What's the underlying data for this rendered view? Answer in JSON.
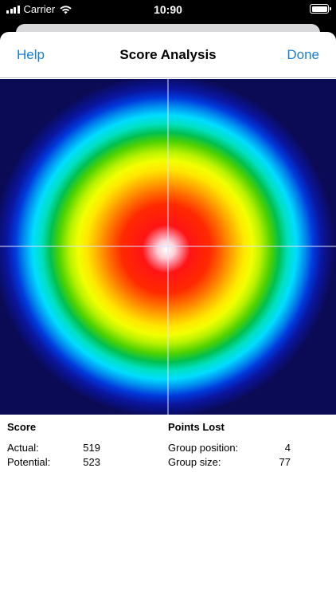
{
  "status_bar": {
    "carrier": "Carrier",
    "time": "10:90"
  },
  "navbar": {
    "help_label": "Help",
    "title": "Score Analysis",
    "done_label": "Done"
  },
  "heatmap": {
    "background_color": "#0b0a55",
    "crosshair_color": "#dde3ff",
    "ring_colors": [
      "#ffffff",
      "#ffd0d8",
      "#ff7a88",
      "#ff1414",
      "#ff2a00",
      "#ff6a00",
      "#ffb000",
      "#ffe800",
      "#f2ff00",
      "#b8f200",
      "#4fd200",
      "#00c050",
      "#00e0c0",
      "#00ddff",
      "#0090f0",
      "#003adc",
      "#0a16a0",
      "#0b0a55"
    ]
  },
  "score": {
    "heading": "Score",
    "actual_label": "Actual:",
    "actual_value": "519",
    "potential_label": "Potential:",
    "potential_value": "523"
  },
  "points_lost": {
    "heading": "Points Lost",
    "group_position_label": "Group position:",
    "group_position_value": "4",
    "group_size_label": "Group size:",
    "group_size_value": "77"
  }
}
